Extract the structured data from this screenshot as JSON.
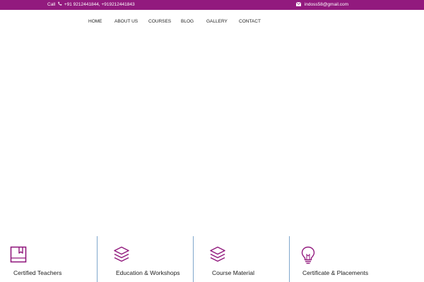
{
  "topbar": {
    "call_label": "Call",
    "phones": "+91 9212441844, +919212441843",
    "email": "indoss58@gmail.com",
    "background": "#921a7e"
  },
  "nav": {
    "items": [
      {
        "label": "HOME"
      },
      {
        "label": "ABOUT US"
      },
      {
        "label": "COURSES"
      },
      {
        "label": "BLOG"
      },
      {
        "label": "GALLERY"
      },
      {
        "label": "CONTACT"
      }
    ]
  },
  "features": {
    "accent": "#921a7e",
    "divider_color": "#7fa7cc",
    "items": [
      {
        "label": "Certified Teachers",
        "icon": "book-icon"
      },
      {
        "label": "Education & Workshops",
        "icon": "layers-icon"
      },
      {
        "label": "Course Material",
        "icon": "layers-icon"
      },
      {
        "label": "Certificate & Placements",
        "icon": "lightbulb-icon"
      }
    ]
  }
}
